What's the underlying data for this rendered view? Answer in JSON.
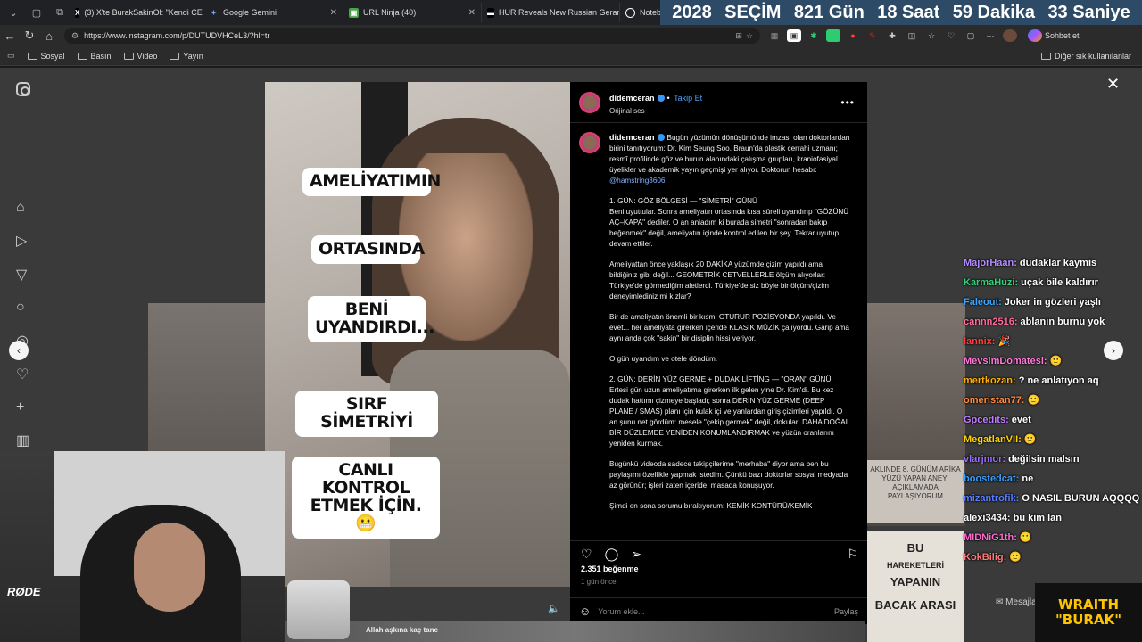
{
  "tabs": [
    {
      "label": "(3) X'te BurakSakinOl: \"Kendi CEO",
      "icon": "x-logo-icon"
    },
    {
      "label": "Google Gemini",
      "icon": "gemini-icon"
    },
    {
      "label": "URL Ninja (40)",
      "icon": "url-ninja-icon"
    },
    {
      "label": "HUR Reveals New Russian Geran",
      "icon": "news-icon"
    },
    {
      "label": "NotebookLM",
      "icon": "notebooklm-icon"
    }
  ],
  "countdown": {
    "year": "2028",
    "label": "SEÇİM",
    "days": "821 Gün",
    "hours": "18 Saat",
    "minutes": "59 Dakika",
    "seconds": "33 Saniye"
  },
  "url": "https://www.instagram.com/p/DUTUDVHCeL3/?hl=tr",
  "copilot_label": "Sohbet et",
  "bookmarks": [
    "Sosyal",
    "Basın",
    "Video",
    "Yayın"
  ],
  "other_bookmarks": "Diğer sık kullanılanlar",
  "video_captions": [
    "AMELİYATIMIN",
    "ORTASINDA",
    "BENİ UYANDIRDI...",
    "SIRF SİMETRİYİ",
    "CANLI KONTROL ETMEK İÇİN. 😬"
  ],
  "post": {
    "username": "didemceran",
    "follow": "Takip Et",
    "audio": "Orijinal ses",
    "caption_intro": "Bugün yüzümün dönüşümünde imzası olan doktorlardan birini tanıtıyorum: Dr. Kim Seung Soo. Braun'da plastik cerrahi uzmanı; resmî profilinde göz ve burun alanındaki çalışma grupları, kraniofasiyal üyelikler ve akademik yayın geçmişi yer alıyor. Doktorun hesabı:",
    "caption_mention": "@hamstring3606",
    "paragraphs": [
      "1. GÜN: GÖZ BÖLGESİ — \"SİMETRİ\" GÜNÜ\nBeni uyuttular. Sonra ameliyatın ortasında kısa süreli uyandırıp \"GÖZÜNÜ AÇ–KAPA\" dediler. O an anladım ki burada simetri \"sonradan bakıp beğenmek\" değil, ameliyatın içinde kontrol edilen bir şey. Tekrar uyutup devam ettiler.",
      "Ameliyattan önce yaklaşık 20 DAKİKA yüzümde çizim yapıldı ama bildiğiniz gibi değil... GEOMETRİK CETVELLERLE ölçüm alıyorlar: Türkiye'de görmediğim aletlerdi. Türkiye'de siz böyle bir ölçüm/çizim deneyimlediniz mi kızlar?",
      "Bir de ameliyatın önemli bir kısmı OTURUR POZİSYONDA yapıldı. Ve evet... her ameliyata girerken içeride KLASİK MÜZİK çalıyordu. Garip ama aynı anda çok \"sakin\" bir disiplin hissi veriyor.",
      "O gün uyandım ve otele döndüm.",
      "2. GÜN: DERİN YÜZ GERME + DUDAK LİFTİNG — \"ORAN\" GÜNÜ\nErtesi gün uzun ameliyatıma girerken ilk gelen yine Dr. Kim'di. Bu kez dudak hattımı çizmeye başladı; sonra DERİN YÜZ GERME (DEEP PLANE / SMAS) planı için kulak içi ve yanlardan giriş çizimleri yapıldı. O an şunu net gördüm: mesele \"çekip germek\" değil, dokuları DAHA DOĞAL BİR DÜZLEMDE YENİDEN KONUMLANDIRMAK ve yüzün oranlarını yeniden kurmak.",
      "Bugünkü videoda sadece takipçilerime \"merhaba\" diyor ama ben bu paylaşımı özellikle yapmak istedim. Çünkü bazı doktorlar sosyal medyada az görünür; işleri zaten içeride, masada konuşuyor.",
      "Şimdi en sona sorumu bırakıyorum: KEMİK KONTÜRÜ/KEMİK"
    ],
    "likes": "2.351 beğenme",
    "time_ago": "1 gün önce",
    "comment_placeholder": "Yorum ekle...",
    "share": "Paylaş"
  },
  "chat": [
    {
      "user": "MajorHaan:",
      "msg": "dudaklar kaymis",
      "color": "#b38cff"
    },
    {
      "user": "KarmaHuzi:",
      "msg": "uçak bile kaldırır",
      "color": "#33d17a"
    },
    {
      "user": "Faleout:",
      "msg": "Joker in gözleri yaşlı",
      "color": "#3ea6ff"
    },
    {
      "user": "cannn2516:",
      "msg": "ablanın burnu yok",
      "color": "#ff6b9a"
    },
    {
      "user": "lannix:",
      "msg": "🎉",
      "color": "#ff4040"
    },
    {
      "user": "MevsimDomatesi:",
      "msg": "🙂",
      "color": "#ff7ad9"
    },
    {
      "user": "mertkozan:",
      "msg": "? ne anlatıyon aq",
      "color": "#ffb000"
    },
    {
      "user": "omeristan77:",
      "msg": "🙂",
      "color": "#ff8a3d"
    },
    {
      "user": "Gpcedits:",
      "msg": "evet",
      "color": "#c17bff"
    },
    {
      "user": "MegatlanVII:",
      "msg": "🙂",
      "color": "#ffd400"
    },
    {
      "user": "vlarjmor:",
      "msg": "değilsin malsın",
      "color": "#9b6bff"
    },
    {
      "user": "boostedcat:",
      "msg": "ne",
      "color": "#3aa0ff"
    },
    {
      "user": "mizantrofik:",
      "msg": "O NASIL BURUN AQQQQ",
      "color": "#5a7dff"
    },
    {
      "user": "alexi3434:",
      "msg": "bu kim lan",
      "color": "#ffffff"
    },
    {
      "user": "MIDNiG1th:",
      "msg": "🙂",
      "color": "#ff6bd0"
    },
    {
      "user": "KokBilig:",
      "msg": "🙂",
      "color": "#ff7a7a"
    }
  ],
  "right_sign_text": "AKLINDE 8. GÜNÜM ARİKA YÜZÜ YAPAN ANEYİ AÇIKLAMADA PAYLAŞIYORUM",
  "right_sign_words": [
    "BU",
    "HAREKETLERİ",
    "YAPANIN",
    "BACAK ARASI"
  ],
  "bottom_text": "Allah aşkına kaç tane",
  "mesajlar": "Mesajlar",
  "webcam_brand": "RØDE",
  "overlay_brand": [
    "WRAITH",
    "\"BURAK\""
  ]
}
